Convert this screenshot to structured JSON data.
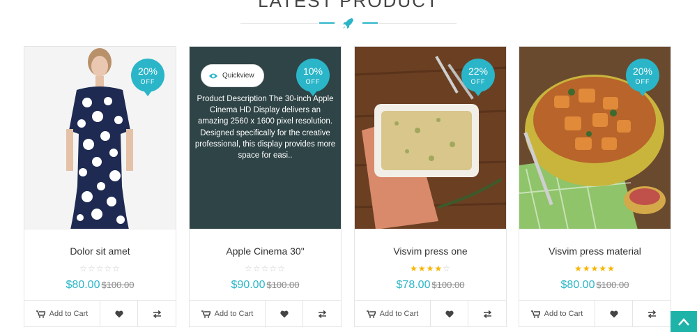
{
  "section": {
    "title": "LATEST PRODUCT"
  },
  "products": [
    {
      "name": "Dolor sit amet",
      "badge_pct": "20%",
      "badge_off": "OFF",
      "rating": 0,
      "price": "$80.00",
      "old_price": "$100.00",
      "add_to_cart": "Add to Cart",
      "image": "woman-polka-dot-dress"
    },
    {
      "name": "Apple Cinema 30\"",
      "badge_pct": "10%",
      "badge_off": "OFF",
      "rating": 0,
      "price": "$90.00",
      "old_price": "$100.00",
      "add_to_cart": "Add to Cart",
      "quickview": "Quickview",
      "description": "Product Description The 30-inch Apple Cinema HD Display delivers an amazing 2560 x 1600 pixel resolution. Designed specifically for the creative professional, this display provides more space for easi.."
    },
    {
      "name": "Visvim press one",
      "badge_pct": "22%",
      "badge_off": "OFF",
      "rating": 4,
      "price": "$78.00",
      "old_price": "$100.00",
      "add_to_cart": "Add to Cart",
      "image": "casserole-dish"
    },
    {
      "name": "Visvim press material",
      "badge_pct": "20%",
      "badge_off": "OFF",
      "rating": 5,
      "price": "$80.00",
      "old_price": "$100.00",
      "add_to_cart": "Add to Cart",
      "image": "roasted-potatoes-bowl"
    }
  ],
  "colors": {
    "accent": "#2bb5c8",
    "star": "#f7b500",
    "overlay": "#2f4447",
    "scroll_top": "#1eb3a8"
  },
  "icons": [
    "rocket-icon",
    "cart-icon",
    "heart-icon",
    "compare-icon",
    "eye-icon",
    "chevron-up-icon"
  ]
}
